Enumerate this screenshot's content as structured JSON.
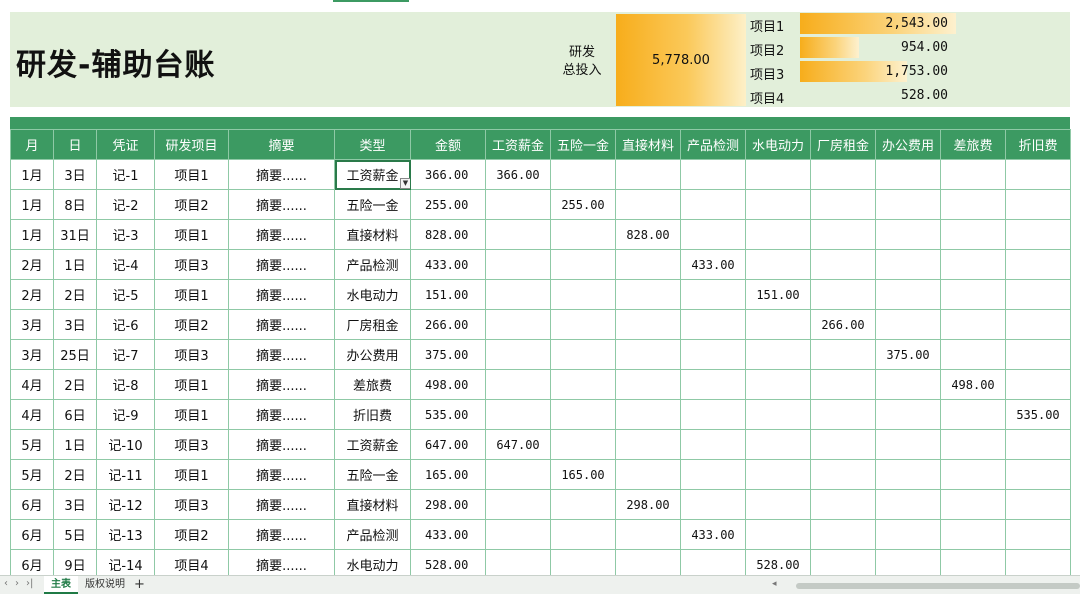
{
  "header": {
    "title": "研发-辅助台账",
    "invest_label": [
      "研发",
      "总投入"
    ],
    "total_invest": "5,778.00",
    "projects": [
      {
        "label": "项目1",
        "value": "2,543.00",
        "share": 1.0
      },
      {
        "label": "项目2",
        "value": "954.00",
        "share": 0.375
      },
      {
        "label": "项目3",
        "value": "1,753.00",
        "share": 0.689
      },
      {
        "label": "项目4",
        "value": "528.00",
        "share": 0.0
      }
    ]
  },
  "table": {
    "columns": [
      "月",
      "日",
      "凭证",
      "研发项目",
      "摘要",
      "类型",
      "金额",
      "工资薪金",
      "五险一金",
      "直接材料",
      "产品检测",
      "水电动力",
      "厂房租金",
      "办公费用",
      "差旅费",
      "折旧费"
    ],
    "rows": [
      [
        "1月",
        "3日",
        "记-1",
        "项目1",
        "摘要......",
        "工资薪金",
        "366.00",
        "366.00",
        "",
        "",
        "",
        "",
        "",
        "",
        "",
        ""
      ],
      [
        "1月",
        "8日",
        "记-2",
        "项目2",
        "摘要......",
        "五险一金",
        "255.00",
        "",
        "255.00",
        "",
        "",
        "",
        "",
        "",
        "",
        ""
      ],
      [
        "1月",
        "31日",
        "记-3",
        "项目1",
        "摘要......",
        "直接材料",
        "828.00",
        "",
        "",
        "828.00",
        "",
        "",
        "",
        "",
        "",
        ""
      ],
      [
        "2月",
        "1日",
        "记-4",
        "项目3",
        "摘要......",
        "产品检测",
        "433.00",
        "",
        "",
        "",
        "433.00",
        "",
        "",
        "",
        "",
        ""
      ],
      [
        "2月",
        "2日",
        "记-5",
        "项目1",
        "摘要......",
        "水电动力",
        "151.00",
        "",
        "",
        "",
        "",
        "151.00",
        "",
        "",
        "",
        ""
      ],
      [
        "3月",
        "3日",
        "记-6",
        "项目2",
        "摘要......",
        "厂房租金",
        "266.00",
        "",
        "",
        "",
        "",
        "",
        "266.00",
        "",
        "",
        ""
      ],
      [
        "3月",
        "25日",
        "记-7",
        "项目3",
        "摘要......",
        "办公费用",
        "375.00",
        "",
        "",
        "",
        "",
        "",
        "",
        "375.00",
        "",
        ""
      ],
      [
        "4月",
        "2日",
        "记-8",
        "项目1",
        "摘要......",
        "差旅费",
        "498.00",
        "",
        "",
        "",
        "",
        "",
        "",
        "",
        "498.00",
        ""
      ],
      [
        "4月",
        "6日",
        "记-9",
        "项目1",
        "摘要......",
        "折旧费",
        "535.00",
        "",
        "",
        "",
        "",
        "",
        "",
        "",
        "",
        "535.00"
      ],
      [
        "5月",
        "1日",
        "记-10",
        "项目3",
        "摘要......",
        "工资薪金",
        "647.00",
        "647.00",
        "",
        "",
        "",
        "",
        "",
        "",
        "",
        ""
      ],
      [
        "5月",
        "2日",
        "记-11",
        "项目1",
        "摘要......",
        "五险一金",
        "165.00",
        "",
        "165.00",
        "",
        "",
        "",
        "",
        "",
        "",
        ""
      ],
      [
        "6月",
        "3日",
        "记-12",
        "项目3",
        "摘要......",
        "直接材料",
        "298.00",
        "",
        "",
        "298.00",
        "",
        "",
        "",
        "",
        "",
        ""
      ],
      [
        "6月",
        "5日",
        "记-13",
        "项目2",
        "摘要......",
        "产品检测",
        "433.00",
        "",
        "",
        "",
        "433.00",
        "",
        "",
        "",
        "",
        ""
      ],
      [
        "6月",
        "9日",
        "记-14",
        "项目4",
        "摘要......",
        "水电动力",
        "528.00",
        "",
        "",
        "",
        "",
        "528.00",
        "",
        "",
        "",
        ""
      ]
    ]
  },
  "sheets": {
    "tabs": [
      "主表",
      "版权说明"
    ],
    "active": "主表",
    "add_label": "+",
    "nav": [
      "‹",
      "›",
      "›|"
    ]
  }
}
